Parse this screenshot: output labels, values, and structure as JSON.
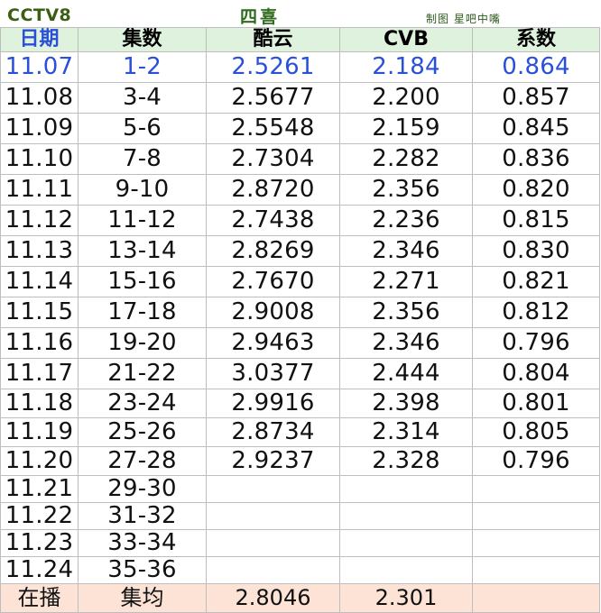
{
  "header": {
    "channel": "CCTV8",
    "show_title": "四喜",
    "credit": "制图 星吧中嘴"
  },
  "table": {
    "columns": [
      "日期",
      "集数",
      "酷云",
      "CVB",
      "系数"
    ],
    "rows": [
      [
        "11.07",
        "1-2",
        "2.5261",
        "2.184",
        "0.864"
      ],
      [
        "11.08",
        "3-4",
        "2.5677",
        "2.200",
        "0.857"
      ],
      [
        "11.09",
        "5-6",
        "2.5548",
        "2.159",
        "0.845"
      ],
      [
        "11.10",
        "7-8",
        "2.7304",
        "2.282",
        "0.836"
      ],
      [
        "11.11",
        "9-10",
        "2.8720",
        "2.356",
        "0.820"
      ],
      [
        "11.12",
        "11-12",
        "2.7438",
        "2.236",
        "0.815"
      ],
      [
        "11.13",
        "13-14",
        "2.8269",
        "2.346",
        "0.830"
      ],
      [
        "11.14",
        "15-16",
        "2.7670",
        "2.271",
        "0.821"
      ],
      [
        "11.15",
        "17-18",
        "2.9008",
        "2.356",
        "0.812"
      ],
      [
        "11.16",
        "19-20",
        "2.9463",
        "2.346",
        "0.796"
      ],
      [
        "11.17",
        "21-22",
        "3.0377",
        "2.444",
        "0.804"
      ],
      [
        "11.18",
        "23-24",
        "2.9916",
        "2.398",
        "0.801"
      ],
      [
        "11.19",
        "25-26",
        "2.8734",
        "2.314",
        "0.805"
      ],
      [
        "11.20",
        "27-28",
        "2.9237",
        "2.328",
        "0.796"
      ],
      [
        "11.21",
        "29-30",
        "",
        "",
        ""
      ],
      [
        "11.22",
        "31-32",
        "",
        "",
        ""
      ],
      [
        "11.23",
        "33-34",
        "",
        "",
        ""
      ],
      [
        "11.24",
        "35-36",
        "",
        "",
        ""
      ]
    ],
    "footer": [
      "在播",
      "集均",
      "2.8046",
      "2.301",
      ""
    ]
  },
  "colors": {
    "header_bg": "#dff2de",
    "footer_bg": "#fde3d6",
    "first_row_text": "#2a4fd8",
    "title_green": "#2f6b1c"
  }
}
